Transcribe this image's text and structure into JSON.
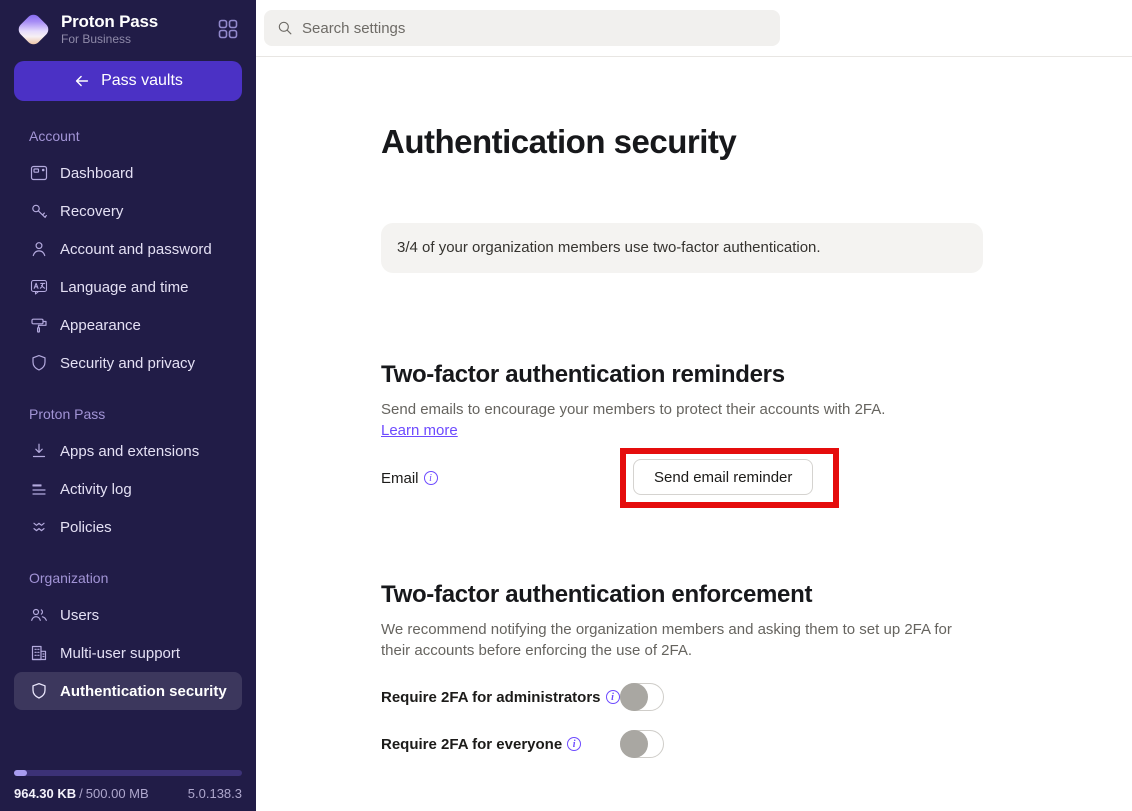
{
  "app": {
    "name": "Proton Pass",
    "subtitle": "For Business"
  },
  "sidebar": {
    "back_button": "Pass vaults",
    "sections": [
      {
        "label": "Account",
        "items": [
          {
            "label": "Dashboard",
            "icon": "dashboard-icon"
          },
          {
            "label": "Recovery",
            "icon": "key-icon"
          },
          {
            "label": "Account and password",
            "icon": "user-icon"
          },
          {
            "label": "Language and time",
            "icon": "language-bubble-icon"
          },
          {
            "label": "Appearance",
            "icon": "paint-roller-icon"
          },
          {
            "label": "Security and privacy",
            "icon": "shield-icon"
          }
        ]
      },
      {
        "label": "Proton Pass",
        "items": [
          {
            "label": "Apps and extensions",
            "icon": "download-icon"
          },
          {
            "label": "Activity log",
            "icon": "list-lines-icon"
          },
          {
            "label": "Policies",
            "icon": "double-chevron-icon"
          }
        ]
      },
      {
        "label": "Organization",
        "items": [
          {
            "label": "Users",
            "icon": "users-icon"
          },
          {
            "label": "Multi-user support",
            "icon": "building-icon"
          },
          {
            "label": "Authentication security",
            "icon": "shield-icon",
            "active": true
          }
        ]
      }
    ],
    "storage": {
      "used": "964.30 KB",
      "separator": "/",
      "total": "500.00 MB",
      "version": "5.0.138.3"
    }
  },
  "header": {
    "search_placeholder": "Search settings"
  },
  "main": {
    "title": "Authentication security",
    "info_banner": "3/4 of your organization members use two-factor authentication.",
    "reminders": {
      "heading": "Two-factor authentication reminders",
      "description": "Send emails to encourage your members to protect their accounts with 2FA.",
      "learn_more": "Learn more",
      "email_label": "Email",
      "send_button": "Send email reminder"
    },
    "enforcement": {
      "heading": "Two-factor authentication enforcement",
      "description": "We recommend notifying the organization members and asking them to set up 2FA for their accounts before enforcing the use of 2FA.",
      "toggles": [
        {
          "label": "Require 2FA for administrators",
          "state": "off"
        },
        {
          "label": "Require 2FA for everyone",
          "state": "off"
        }
      ]
    }
  },
  "colors": {
    "sidebar_bg": "#211c47",
    "accent_purple": "#4b31c5",
    "link_purple": "#6d4aff",
    "annotation_red": "#e50d0d",
    "banner_bg": "#f4f3f1"
  }
}
